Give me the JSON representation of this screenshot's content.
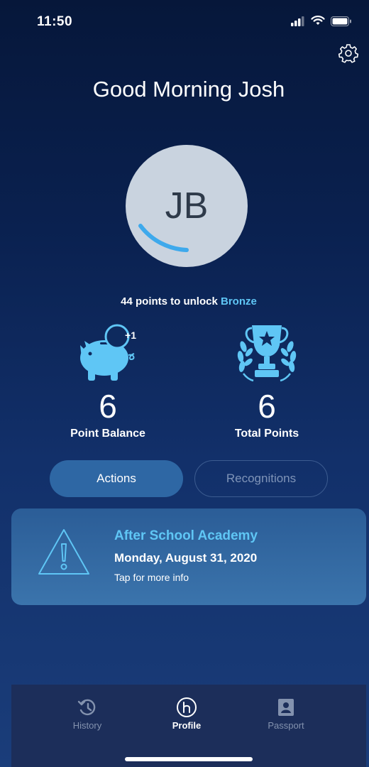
{
  "status_bar": {
    "time": "11:50"
  },
  "header": {
    "greeting": "Good Morning Josh"
  },
  "avatar": {
    "initials": "JB",
    "progress_fraction": 0.12
  },
  "unlock": {
    "prefix": "44 points to unlock",
    "tier": "Bronze"
  },
  "stats": [
    {
      "value": "6",
      "label": "Point Balance",
      "icon": "piggy-bank-icon",
      "badge": "+1"
    },
    {
      "value": "6",
      "label": "Total Points",
      "icon": "trophy-icon"
    }
  ],
  "tabs": [
    {
      "label": "Actions",
      "active": true
    },
    {
      "label": "Recognitions",
      "active": false
    }
  ],
  "event_card": {
    "title": "After School Academy",
    "date": "Monday, August 31, 2020",
    "info": "Tap for more info",
    "icon": "warning-icon"
  },
  "bottom_nav": [
    {
      "label": "History",
      "icon": "history-icon",
      "active": false
    },
    {
      "label": "Profile",
      "icon": "profile-h-icon",
      "active": true
    },
    {
      "label": "Passport",
      "icon": "passport-icon",
      "active": false
    }
  ],
  "colors": {
    "accent": "#5fc6f5",
    "active_tab": "#2e67a4",
    "card": "#3468a2",
    "tabbar": "#1c2e5a"
  }
}
